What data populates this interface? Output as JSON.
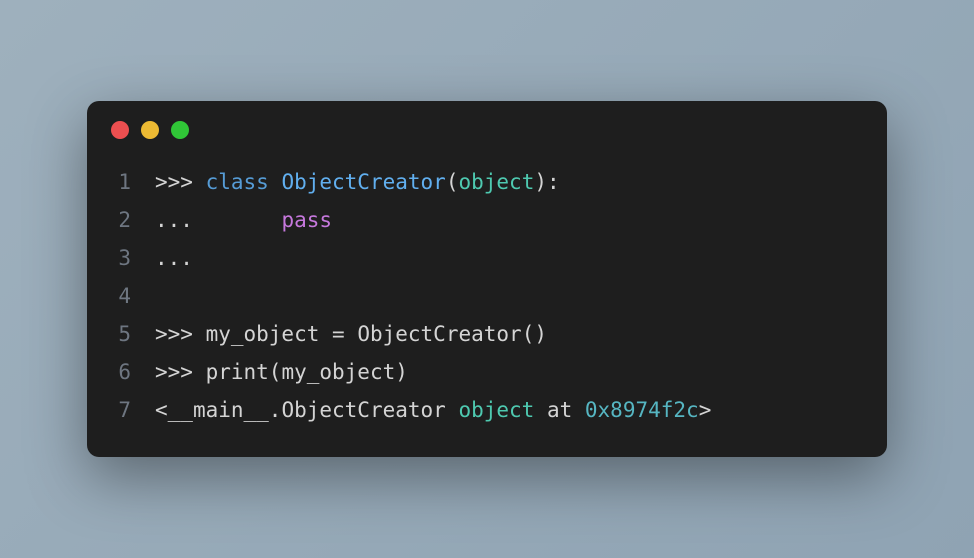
{
  "window": {
    "buttons": {
      "close": "close",
      "minimize": "minimize",
      "maximize": "maximize"
    }
  },
  "code": {
    "lines": [
      {
        "number": "1"
      },
      {
        "number": "2"
      },
      {
        "number": "3"
      },
      {
        "number": "4"
      },
      {
        "number": "5"
      },
      {
        "number": "6"
      },
      {
        "number": "7"
      }
    ],
    "line1": {
      "prompt": ">>> ",
      "class_kw": "class",
      "sp1": " ",
      "classname": "ObjectCreator",
      "lparen": "(",
      "base": "object",
      "rparen": ")",
      "colon": ":"
    },
    "line2": {
      "cont": "...       ",
      "pass_kw": "pass"
    },
    "line3": {
      "cont": "..."
    },
    "line4": {
      "empty": ""
    },
    "line5": {
      "prompt": ">>> ",
      "var": "my_object ",
      "eq": "=",
      "sp": " ",
      "call": "ObjectCreator",
      "lparen": "(",
      "rparen": ")"
    },
    "line6": {
      "prompt": ">>> ",
      "fn": "print",
      "lparen": "(",
      "arg": "my_object",
      "rparen": ")"
    },
    "line7": {
      "lt": "<",
      "mod": "__main__.ObjectCreator ",
      "obj": "object",
      "at": " at ",
      "addr": "0x8974f2c",
      "gt": ">"
    }
  }
}
